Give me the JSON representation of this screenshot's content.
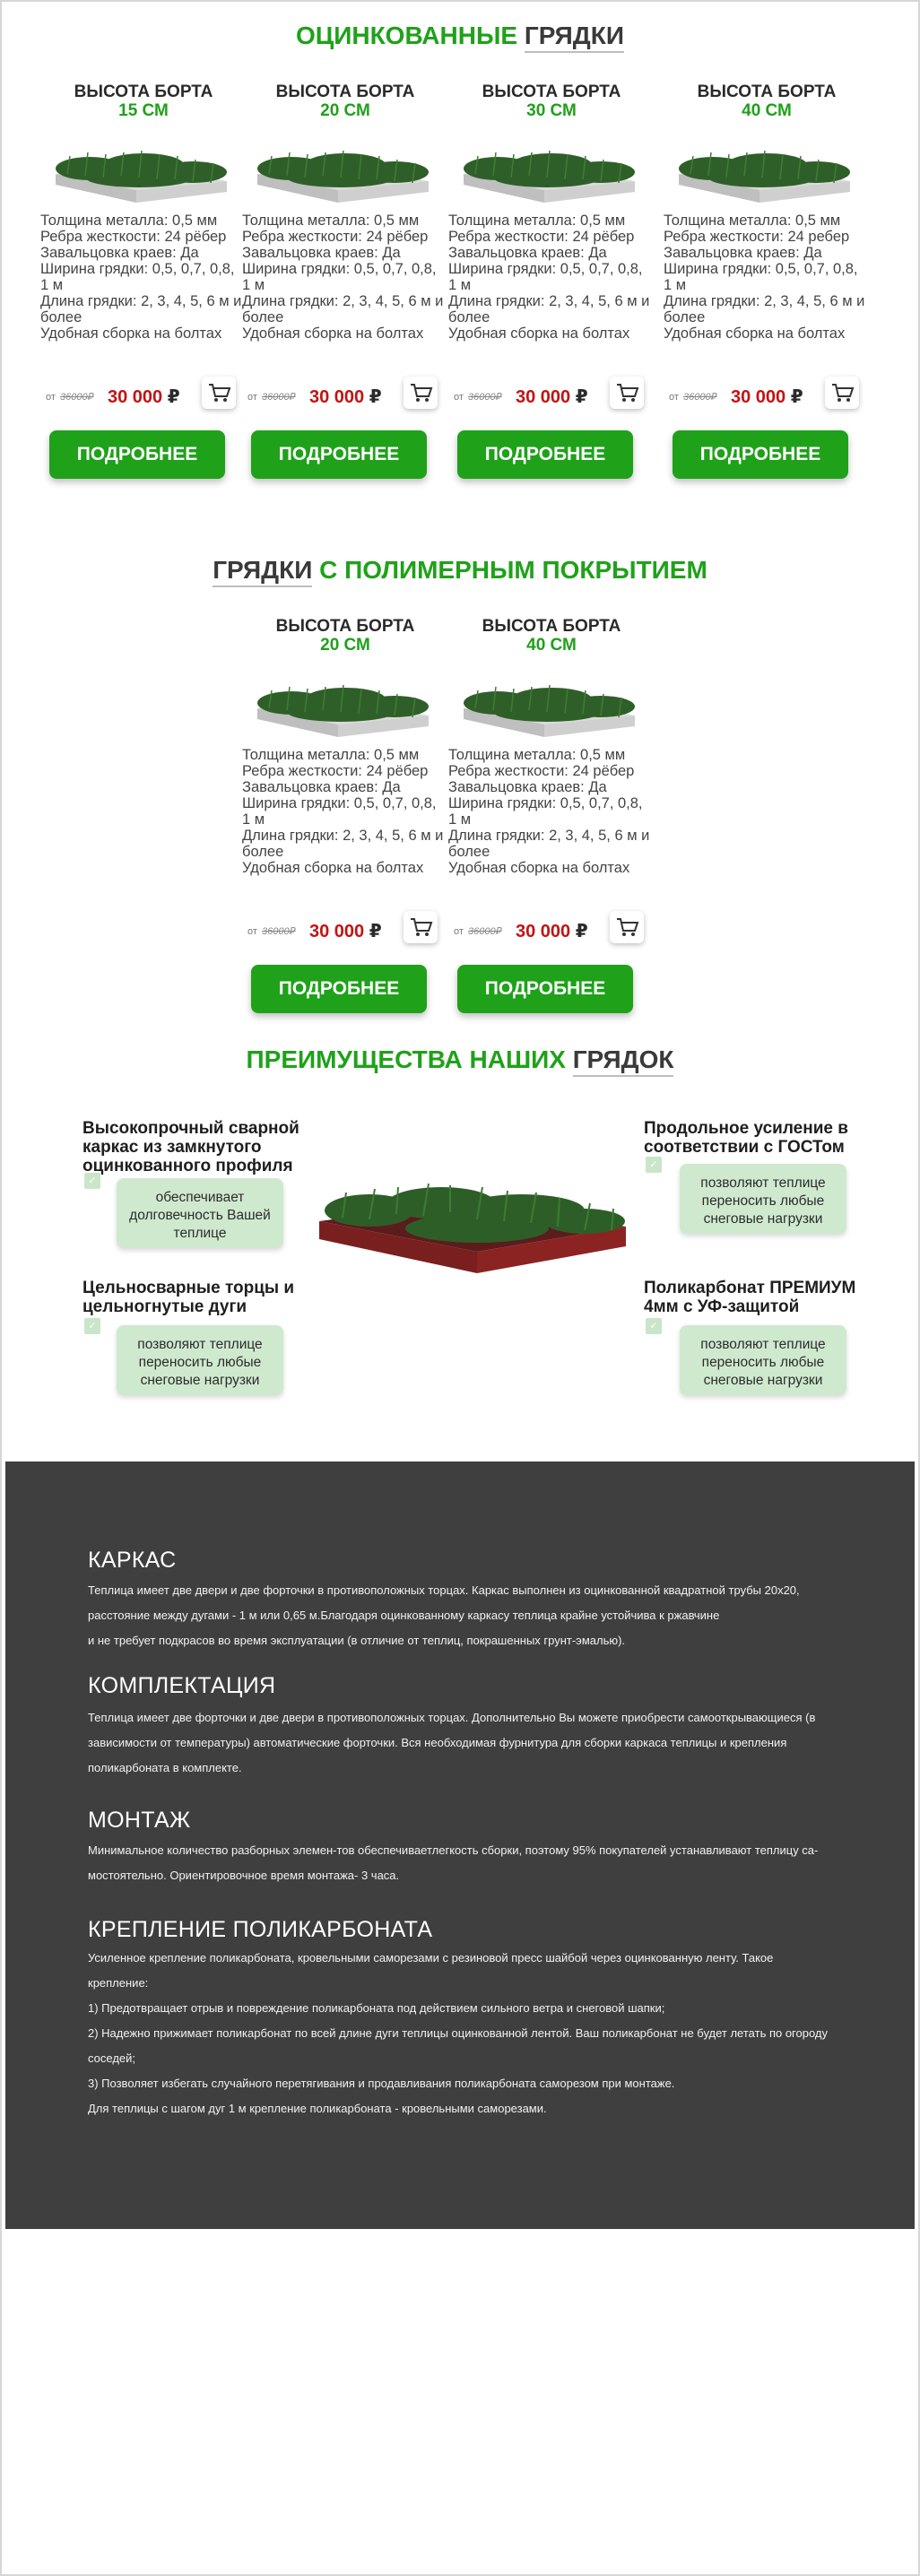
{
  "colors": {
    "accent_green": "#1fa11a",
    "price_red": "#c21313",
    "dark_block_bg": "#3f3f3f",
    "light_green_box": "#cfe9cf"
  },
  "section1": {
    "title_green": "ОЦИНКОВАННЫЕ",
    "title_dark": "ГРЯДКИ"
  },
  "section2": {
    "title_dark": "ГРЯДКИ",
    "title_green": "С ПОЛИМЕРНЫМ ПОКРЫТИЕМ"
  },
  "cards_galv": [
    {
      "heading": "ВЫСОТА БОРТА",
      "height": "15 СМ",
      "specs": [
        "Толщина металла: 0,5 мм",
        "Ребра жесткости: 24 рёбер",
        "Завальцовка краев: Да",
        "Ширина грядки: 0,5, 0,7, 0,8, 1 м",
        "Длина грядки: 2, 3, 4, 5, 6 м и более",
        "Удобная сборка на болтах"
      ],
      "price_from": "от",
      "price_old": "36000₽",
      "price_new": "30 000",
      "currency": "₽",
      "button": "ПОДРОБНЕЕ"
    },
    {
      "heading": "ВЫСОТА БОРТА",
      "height": "20 СМ",
      "specs": [
        "Толщина металла: 0,5 мм",
        "Ребра жесткости: 24 рёбер",
        "Завальцовка краев: Да",
        "Ширина грядки: 0,5, 0,7, 0,8, 1 м",
        "Длина грядки: 2, 3, 4, 5, 6 м и более",
        "Удобная сборка на болтах"
      ],
      "price_from": "от",
      "price_old": "36000₽",
      "price_new": "30 000",
      "currency": "₽",
      "button": "ПОДРОБНЕЕ"
    },
    {
      "heading": "ВЫСОТА БОРТА",
      "height": "30 СМ",
      "specs": [
        "Толщина металла: 0,5 мм",
        "Ребра жесткости: 24 рёбер",
        "Завальцовка краев: Да",
        "Ширина грядки: 0,5, 0,7, 0,8, 1 м",
        "Длина грядки: 2, 3, 4, 5, 6 м и более",
        "Удобная сборка на болтах"
      ],
      "price_from": "от",
      "price_old": "36000₽",
      "price_new": "30 000",
      "currency": "₽",
      "button": "ПОДРОБНЕЕ"
    },
    {
      "heading": "ВЫСОТА БОРТА",
      "height": "40 СМ",
      "specs": [
        "Толщина металла: 0,5 мм",
        "Ребра жесткости: 24 ребер",
        "Завальцовка краев: Да",
        "Ширина грядки: 0,5, 0,7, 0,8, 1 м",
        "Длина грядки: 2, 3, 4, 5, 6 м и более",
        "Удобная сборка на болтах"
      ],
      "price_from": "от",
      "price_old": "36000₽",
      "price_new": "30 000",
      "currency": "₽",
      "button": "ПОДРОБНЕЕ"
    }
  ],
  "cards_poly": [
    {
      "heading": "ВЫСОТА БОРТА",
      "height": "20 СМ",
      "specs": [
        "Толщина металла: 0,5 мм",
        "Ребра жесткости: 24 рёбер",
        "Завальцовка краев: Да",
        "Ширина грядки: 0,5, 0,7, 0,8, 1 м",
        "Длина грядки: 2, 3, 4, 5, 6 м и более",
        "Удобная сборка на болтах"
      ],
      "price_from": "от",
      "price_old": "36000₽",
      "price_new": "30 000",
      "currency": "₽",
      "button": "ПОДРОБНЕЕ"
    },
    {
      "heading": "ВЫСОТА БОРТА",
      "height": "40 СМ",
      "specs": [
        "Толщина металла: 0,5 мм",
        "Ребра жесткости: 24 рёбер",
        "Завальцовка краев: Да",
        "Ширина грядки: 0,5, 0,7, 0,8, 1 м",
        "Длина грядки: 2, 3, 4, 5, 6 м и более",
        "Удобная сборка на болтах"
      ],
      "price_from": "от",
      "price_old": "36000₽",
      "price_new": "30 000",
      "currency": "₽",
      "button": "ПОДРОБНЕЕ"
    }
  ],
  "advantages": {
    "title_green": "ПРЕИМУЩЕСТВА НАШИХ",
    "title_dark": "ГРЯДОК",
    "items": [
      {
        "title": "Высокопрочный сварной каркас из замкнутого оцинкованного профиля",
        "text": "обеспечивает долговечность Вашей теплице"
      },
      {
        "title": "Цельносварные торцы и цельногнутые дуги",
        "text": "позволяют теплице переносить любые снеговые нагрузки"
      },
      {
        "title": "Продольное усиление в соответствии с ГОСТом",
        "text": "позволяют теплице переносить любые снеговые нагрузки"
      },
      {
        "title": "Поликарбонат ПРЕМИУМ 4мм с УФ-защитой",
        "text": "позволяют теплице переносить любые снеговые нагрузки"
      }
    ]
  },
  "info": {
    "karkas": {
      "heading": "КАРКАС",
      "lines": [
        "Теплица имеет две двери и две форточки в противоположных торцах. Каркас выполнен из оцинкованной квадратной трубы 20х20,",
        "расстояние между дугами - 1 м или 0,65 м.Благодаря оцинкованному каркасу теплица крайне устойчива к ржавчине",
        "и не требует подкрасов во время эксплуатации (в отличие от теплиц, покрашенных грунт-эмалью)."
      ]
    },
    "komplekt": {
      "heading": "КОМПЛЕКТАЦИЯ",
      "lines": [
        "Теплица имеет две форточки и две двери в противоположных торцах. Дополнительно Вы можете приобрести самооткрывающиеся (в",
        "зависимости от температуры) автоматические форточки. Вся необходимая фурнитура для сборки каркаса теплицы и крепления",
        "поликарбоната в комплекте."
      ]
    },
    "montazh": {
      "heading": "МОНТАЖ",
      "lines": [
        "Минимальное количество разборных элемен-тов обеспечиваетлегкость сборки, поэтому 95% покупателей устанавливают теплицу са-",
        "мостоятельно. Ориентировочное время монтажа- 3 часа."
      ]
    },
    "kreplenie": {
      "heading": "КРЕПЛЕНИЕ ПОЛИКАРБОНАТА",
      "lines": [
        "Усиленное крепление поликарбоната, кровельными саморезами с резиновой пресс шайбой через оцинкованную ленту. Такое",
        "крепление:",
        "1) Предотвращает отрыв и повреждение поликарбоната под действием сильного ветра и снеговой шапки;",
        "2) Надежно прижимает поликарбонат по всей длине дуги теплицы оцинкованной лентой. Ваш поликарбонат не будет летать по огороду",
        "соседей;",
        "3) Позволяет избегать случайного перетягивания и продавливания поликарбоната саморезом при монтаже.",
        "Для теплицы с шагом дуг 1 м крепление поликарбоната - кровельными саморезами."
      ]
    }
  }
}
